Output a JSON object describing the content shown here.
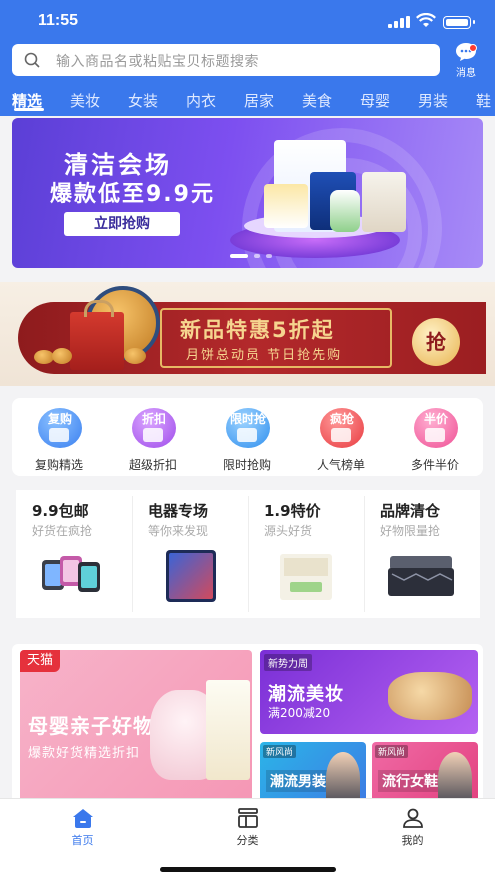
{
  "status_bar": {
    "time": "11:55"
  },
  "search": {
    "placeholder": "输入商品名或粘贴宝贝标题搜索"
  },
  "message": {
    "label": "消息"
  },
  "categories": [
    "精选",
    "美妆",
    "女装",
    "内衣",
    "居家",
    "美食",
    "母婴",
    "男装",
    "鞋"
  ],
  "banner_cleaning": {
    "title": "清洁会场",
    "subtitle": "爆款低至9.9元",
    "button": "立即抢购"
  },
  "banner_festival": {
    "title": "新品特惠5折起",
    "subtitle": "月饼总动员  节日抢先购",
    "button": "抢"
  },
  "quick_entries": [
    {
      "tag": "复购",
      "label": "复购精选",
      "color": "#4a8ef0"
    },
    {
      "tag": "折扣",
      "label": "超级折扣",
      "color": "#b45cf0"
    },
    {
      "tag": "限时抢",
      "label": "限时抢购",
      "color": "#3b9cf2"
    },
    {
      "tag": "疯抢",
      "label": "人气榜单",
      "color": "#f0474d"
    },
    {
      "tag": "半价",
      "label": "多件半价",
      "color": "#f05a9c"
    }
  ],
  "channels": [
    {
      "title": "9.9包邮",
      "subtitle": "好货在疯抢"
    },
    {
      "title": "电器专场",
      "subtitle": "等你来发现"
    },
    {
      "title": "1.9特价",
      "subtitle": "源头好货"
    },
    {
      "title": "品牌清仓",
      "subtitle": "好物限量抢"
    }
  ],
  "promo": {
    "mother_baby": {
      "badge": "天猫",
      "title": "母婴亲子好物",
      "subtitle": "爆款好货精选折扣"
    },
    "makeup": {
      "tag": "新势力周",
      "title": "潮流美妆",
      "subtitle": "满200减20"
    },
    "menswear": {
      "tag": "新风尚",
      "title": "潮流男装"
    },
    "womens_shoes": {
      "tag": "新风尚",
      "title": "流行女鞋"
    }
  },
  "tabbar": [
    {
      "label": "首页",
      "active": true
    },
    {
      "label": "分类",
      "active": false
    },
    {
      "label": "我的",
      "active": false
    }
  ],
  "colors": {
    "accent": "#3a78ec",
    "background": "#f3f3f5"
  }
}
